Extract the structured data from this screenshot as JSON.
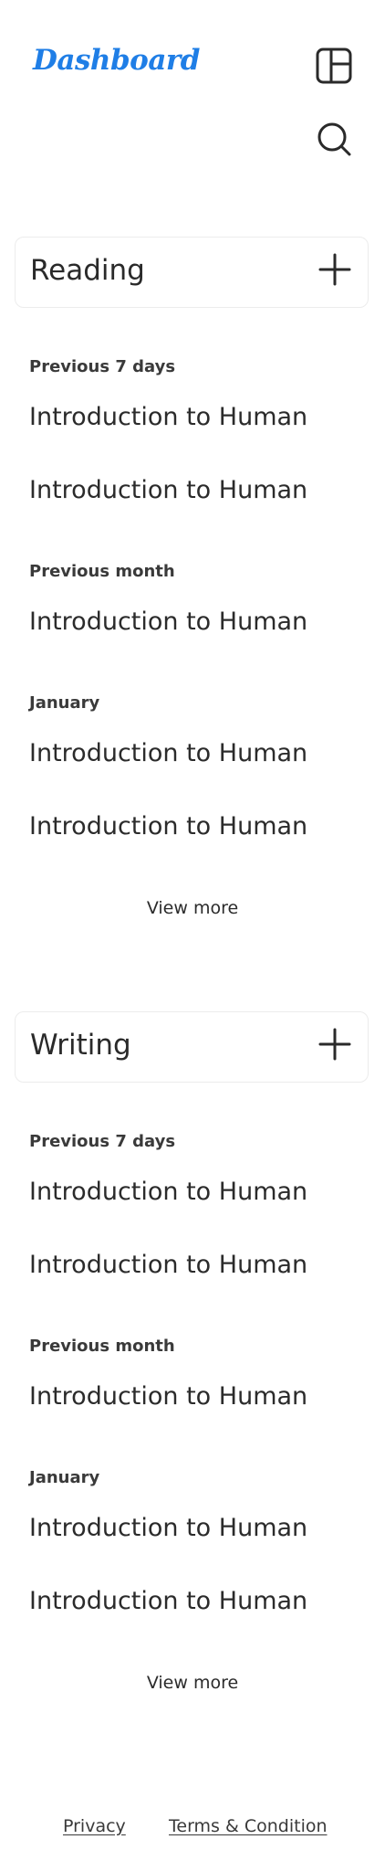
{
  "header": {
    "logo_text": "Dashboard",
    "layout_icon": "layout-panel-icon",
    "search_icon": "search-icon"
  },
  "sections": [
    {
      "title": "Reading",
      "add_icon": "plus-icon",
      "groups": [
        {
          "label": "Previous 7 days",
          "items": [
            "Introduction to Human A",
            "Introduction to Human A"
          ]
        },
        {
          "label": "Previous month",
          "items": [
            "Introduction to Human A"
          ]
        },
        {
          "label": "January",
          "items": [
            "Introduction to Human A",
            "Introduction to Human A"
          ]
        }
      ],
      "view_more": "View more"
    },
    {
      "title": "Writing",
      "add_icon": "plus-icon",
      "groups": [
        {
          "label": "Previous 7 days",
          "items": [
            "Introduction to Human A",
            "Introduction to Human A"
          ]
        },
        {
          "label": "Previous month",
          "items": [
            "Introduction to Human A"
          ]
        },
        {
          "label": "January",
          "items": [
            "Introduction to Human A",
            "Introduction to Human A"
          ]
        }
      ],
      "view_more": "View more"
    }
  ],
  "footer": {
    "privacy": "Privacy",
    "terms": "Terms & Condition"
  },
  "colors": {
    "brand": "#1f7ee6",
    "text": "#2a2a2a",
    "card_border": "#ececec"
  }
}
